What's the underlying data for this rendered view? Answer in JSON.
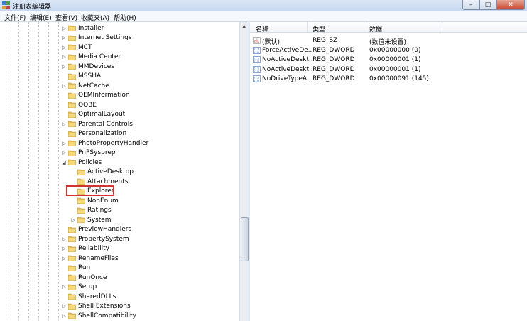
{
  "window": {
    "title": "注册表编辑器"
  },
  "menu": [
    "文件(F)",
    "编辑(E)",
    "查看(V)",
    "收藏夹(A)",
    "帮助(H)"
  ],
  "tree": [
    {
      "label": "Installer",
      "expander": "▷",
      "depth": 0
    },
    {
      "label": "Internet Settings",
      "expander": "▷",
      "depth": 0
    },
    {
      "label": "MCT",
      "expander": "▷",
      "depth": 0
    },
    {
      "label": "Media Center",
      "expander": "▷",
      "depth": 0
    },
    {
      "label": "MMDevices",
      "expander": "▷",
      "depth": 0
    },
    {
      "label": "MSSHA",
      "expander": "",
      "depth": 0
    },
    {
      "label": "NetCache",
      "expander": "▷",
      "depth": 0
    },
    {
      "label": "OEMInformation",
      "expander": "",
      "depth": 0
    },
    {
      "label": "OOBE",
      "expander": "",
      "depth": 0
    },
    {
      "label": "OptimalLayout",
      "expander": "",
      "depth": 0
    },
    {
      "label": "Parental Controls",
      "expander": "▷",
      "depth": 0
    },
    {
      "label": "Personalization",
      "expander": "",
      "depth": 0
    },
    {
      "label": "PhotoPropertyHandler",
      "expander": "▷",
      "depth": 0
    },
    {
      "label": "PnPSysprep",
      "expander": "▷",
      "depth": 0
    },
    {
      "label": "Policies",
      "expander": "◢",
      "depth": 0
    },
    {
      "label": "ActiveDesktop",
      "expander": "",
      "depth": 1
    },
    {
      "label": "Attachments",
      "expander": "",
      "depth": 1
    },
    {
      "label": "Explorer",
      "expander": "",
      "depth": 1
    },
    {
      "label": "NonEnum",
      "expander": "",
      "depth": 1
    },
    {
      "label": "Ratings",
      "expander": "",
      "depth": 1
    },
    {
      "label": "System",
      "expander": "▷",
      "depth": 1
    },
    {
      "label": "PreviewHandlers",
      "expander": "",
      "depth": 0
    },
    {
      "label": "PropertySystem",
      "expander": "▷",
      "depth": 0
    },
    {
      "label": "Reliability",
      "expander": "▷",
      "depth": 0
    },
    {
      "label": "RenameFiles",
      "expander": "▷",
      "depth": 0
    },
    {
      "label": "Run",
      "expander": "",
      "depth": 0
    },
    {
      "label": "RunOnce",
      "expander": "",
      "depth": 0
    },
    {
      "label": "Setup",
      "expander": "▷",
      "depth": 0
    },
    {
      "label": "SharedDLLs",
      "expander": "",
      "depth": 0
    },
    {
      "label": "Shell Extensions",
      "expander": "▷",
      "depth": 0
    },
    {
      "label": "ShellCompatibility",
      "expander": "▷",
      "depth": 0
    }
  ],
  "list": {
    "headers": [
      "名称",
      "类型",
      "数据"
    ],
    "rows": [
      {
        "icon": "string-value-icon",
        "name": "(默认)",
        "type": "REG_SZ",
        "data": "(数值未设置)"
      },
      {
        "icon": "dword-value-icon",
        "name": "ForceActiveDe...",
        "type": "REG_DWORD",
        "data": "0x00000000 (0)"
      },
      {
        "icon": "dword-value-icon",
        "name": "NoActiveDeskt...",
        "type": "REG_DWORD",
        "data": "0x00000001 (1)"
      },
      {
        "icon": "dword-value-icon",
        "name": "NoActiveDeskt...",
        "type": "REG_DWORD",
        "data": "0x00000001 (1)"
      },
      {
        "icon": "dword-value-icon",
        "name": "NoDriveTypeA...",
        "type": "REG_DWORD",
        "data": "0x00000091 (145)"
      }
    ]
  },
  "colors": {
    "highlight": "#d1342f",
    "folder": "#e8c35c"
  }
}
